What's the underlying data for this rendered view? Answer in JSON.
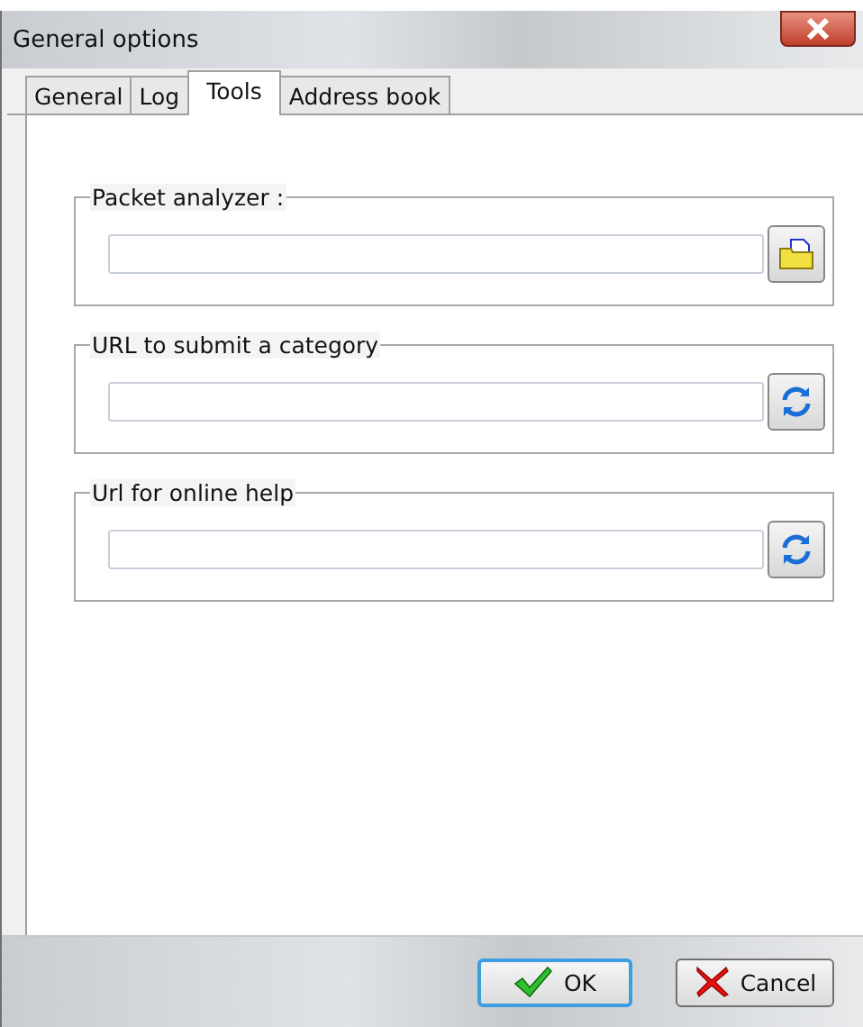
{
  "window": {
    "title": "General options"
  },
  "tabs": [
    {
      "label": "General",
      "selected": false
    },
    {
      "label": "Log",
      "selected": false
    },
    {
      "label": "Tools",
      "selected": true
    },
    {
      "label": "Address book",
      "selected": false
    }
  ],
  "groups": [
    {
      "label": "Packet analyzer :",
      "kind": "folder"
    },
    {
      "label": "URL to submit a category",
      "kind": "refresh"
    },
    {
      "label": "Url for online help",
      "kind": "refresh"
    }
  ],
  "buttons": [
    {
      "label": "OK",
      "kind": "ok",
      "focused": true
    },
    {
      "label": "Cancel",
      "kind": "cancel",
      "focused": false
    }
  ]
}
